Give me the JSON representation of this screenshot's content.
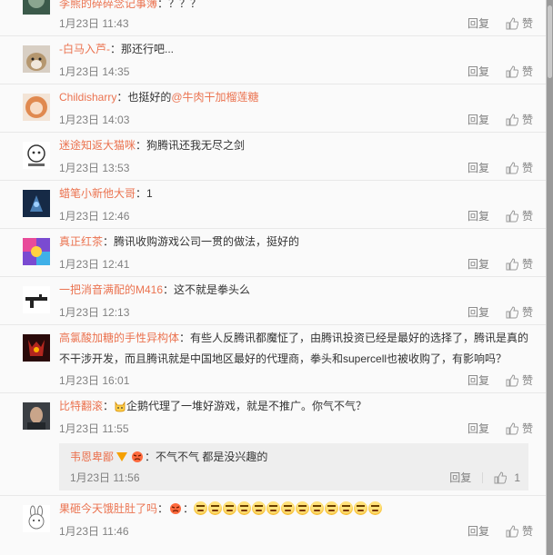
{
  "comments": [
    {
      "user": "李熊的碎碎念记事簿",
      "text": "：？？？",
      "time": "1月23日 11:43",
      "reply": "回复",
      "like": "赞"
    },
    {
      "user": "-白马入芦-",
      "text": "：那还行吧...",
      "time": "1月23日 14:35",
      "reply": "回复",
      "like": "赞"
    },
    {
      "user": "Childisharry",
      "text": "：也挺好的",
      "mention": "@牛肉干加榴莲糖",
      "time": "1月23日 14:03",
      "reply": "回复",
      "like": "赞"
    },
    {
      "user": "迷途知返大猫咪",
      "text": "：狗腾讯还我无尽之剑",
      "time": "1月23日 13:53",
      "reply": "回复",
      "like": "赞"
    },
    {
      "user": "蜡笔小新他大哥",
      "text": "：1",
      "time": "1月23日 12:46",
      "reply": "回复",
      "like": "赞"
    },
    {
      "user": "真正红茶",
      "text": "：腾讯收购游戏公司一贯的做法，挺好的",
      "time": "1月23日 12:41",
      "reply": "回复",
      "like": "赞"
    },
    {
      "user": "一把消音满配的M416",
      "text": "：这不就是拳头么",
      "time": "1月23日 12:13",
      "reply": "回复",
      "like": "赞"
    },
    {
      "user": "高氯酸加糖的手性异构体",
      "text": "：有些人反腾讯都魔怔了，由腾讯投资已经是最好的选择了，腾讯是真的",
      "text2": "不干涉开发，而且腾讯就是中国地区最好的代理商，拳头和supercell也被收购了，有影响吗？",
      "time": "1月23日 16:01",
      "reply": "回复",
      "like": "赞"
    },
    {
      "user": "比特翻滚",
      "text": "企鹅代理了一堆好游戏，就是不推广。你气不气？",
      "time": "1月23日 11:55",
      "reply": "回复",
      "like": "赞"
    },
    {
      "user": "果砸今天饿肚肚了吗",
      "text": "：",
      "time": "1月23日 11:46",
      "reply": "回复",
      "like": "赞"
    }
  ],
  "sub_reply": {
    "user": "韦恩卑鄙",
    "text": "：不气不气 都是没兴趣的",
    "time": "1月23日 11:56",
    "reply": "回复",
    "like_count": "1"
  },
  "colors": {
    "username": "#eb7350",
    "background": "#fafafa",
    "subreply_bg": "#eeeeee"
  }
}
